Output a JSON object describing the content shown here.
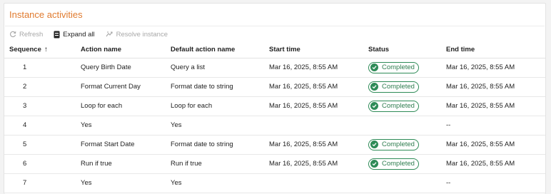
{
  "panel": {
    "title": "Instance activities"
  },
  "toolbar": {
    "refresh_label": "Refresh",
    "expand_all_label": "Expand all",
    "resolve_instance_label": "Resolve instance"
  },
  "table": {
    "columns": [
      "Sequence",
      "Action name",
      "Default action name",
      "Start time",
      "Status",
      "End time"
    ],
    "sort_indicator": "↑",
    "rows": [
      {
        "sequence": "1",
        "action_name": "Query Birth Date",
        "default_action_name": "Query a list",
        "start_time": "Mar 16, 2025, 8:55 AM",
        "status": "Completed",
        "end_time": "Mar 16, 2025, 8:55 AM"
      },
      {
        "sequence": "2",
        "action_name": "Format Current Day",
        "default_action_name": "Format date to string",
        "start_time": "Mar 16, 2025, 8:55 AM",
        "status": "Completed",
        "end_time": "Mar 16, 2025, 8:55 AM"
      },
      {
        "sequence": "3",
        "action_name": "Loop for each",
        "default_action_name": "Loop for each",
        "start_time": "Mar 16, 2025, 8:55 AM",
        "status": "Completed",
        "end_time": "Mar 16, 2025, 8:55 AM"
      },
      {
        "sequence": "4",
        "action_name": "Yes",
        "default_action_name": "Yes",
        "start_time": "",
        "status": "",
        "end_time": "--"
      },
      {
        "sequence": "5",
        "action_name": "Format Start Date",
        "default_action_name": "Format date to string",
        "start_time": "Mar 16, 2025, 8:55 AM",
        "status": "Completed",
        "end_time": "Mar 16, 2025, 8:55 AM"
      },
      {
        "sequence": "6",
        "action_name": "Run if true",
        "default_action_name": "Run if true",
        "start_time": "Mar 16, 2025, 8:55 AM",
        "status": "Completed",
        "end_time": "Mar 16, 2025, 8:55 AM"
      },
      {
        "sequence": "7",
        "action_name": "Yes",
        "default_action_name": "Yes",
        "start_time": "",
        "status": "",
        "end_time": "--"
      }
    ]
  },
  "colors": {
    "title": "#e07a2e",
    "status_completed": "#2e8b57",
    "toolbar_disabled": "#a8a8a8"
  },
  "icons": {
    "refresh": "refresh-icon",
    "expand_all": "expand-all-icon",
    "resolve_instance": "resolve-icon",
    "status": "check-circle-icon",
    "sort": "sort-ascending-icon"
  }
}
